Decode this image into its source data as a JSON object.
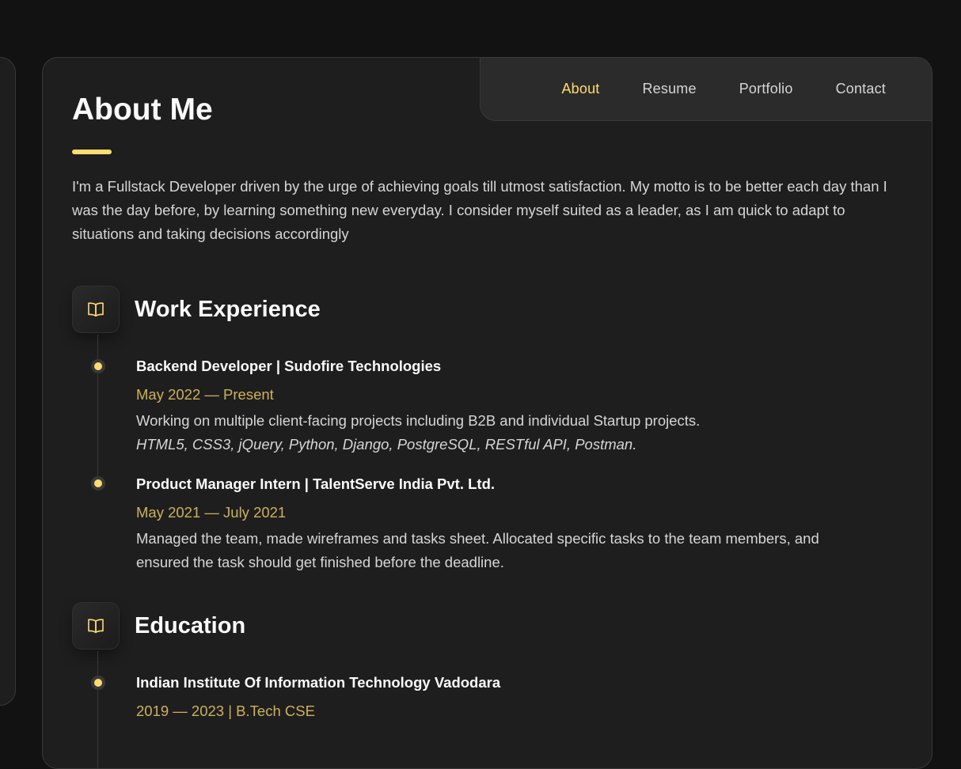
{
  "nav": {
    "items": [
      {
        "label": "About",
        "active": true
      },
      {
        "label": "Resume",
        "active": false
      },
      {
        "label": "Portfolio",
        "active": false
      },
      {
        "label": "Contact",
        "active": false
      }
    ]
  },
  "colors": {
    "accent": "#ffdb70",
    "date": "#ceb15a",
    "background": "#121212",
    "card": "#1e1e1f",
    "text": "#d6d6d6",
    "heading": "#fafafa"
  },
  "about": {
    "title": "About Me",
    "text": "I'm a Fullstack Developer driven by the urge of achieving goals till utmost satisfaction. My motto is to be better each day than I was the day before, by learning something new everyday. I consider myself suited as a leader, as I am quick to adapt to situations and taking decisions accordingly"
  },
  "work": {
    "icon": "book-open-icon",
    "title": "Work Experience",
    "items": [
      {
        "title": "Backend Developer | Sudofire Technologies",
        "date": "May 2022 — Present",
        "description": "Working on multiple client-facing projects including B2B and individual Startup projects.",
        "tech": "HTML5, CSS3, jQuery, Python, Django, PostgreSQL, RESTful API, Postman."
      },
      {
        "title": "Product Manager Intern | TalentServe India Pvt. Ltd.",
        "date": "May 2021 — July 2021",
        "description": "Managed the team, made wireframes and tasks sheet. Allocated specific tasks to the team members, and ensured the task should get finished before the deadline."
      }
    ]
  },
  "education": {
    "icon": "book-open-icon",
    "title": "Education",
    "items": [
      {
        "title": "Indian Institute Of Information Technology Vadodara",
        "date": "2019 — 2023 | B.Tech CSE"
      }
    ]
  }
}
